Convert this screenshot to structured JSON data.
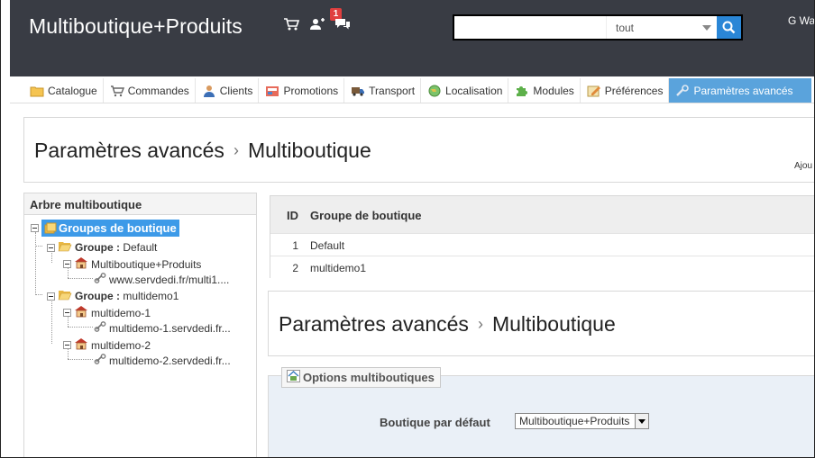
{
  "header": {
    "brand": "Multiboutique+Produits",
    "notifications_count": "1",
    "search_placeholder": "",
    "search_scope": "tout",
    "user": "G Wa"
  },
  "tabs": [
    {
      "label": "Catalogue",
      "icon": "folder-icon"
    },
    {
      "label": "Commandes",
      "icon": "cart-icon"
    },
    {
      "label": "Clients",
      "icon": "user-icon"
    },
    {
      "label": "Promotions",
      "icon": "promotion-icon"
    },
    {
      "label": "Transport",
      "icon": "truck-icon"
    },
    {
      "label": "Localisation",
      "icon": "globe-icon"
    },
    {
      "label": "Modules",
      "icon": "puzzle-icon"
    },
    {
      "label": "Préférences",
      "icon": "preferences-icon"
    },
    {
      "label": "Paramètres avancés",
      "icon": "tools-icon"
    }
  ],
  "page_title": {
    "parent": "Paramètres avancés",
    "current": "Multiboutique",
    "action_truncated": "Ajou"
  },
  "tree": {
    "title": "Arbre multiboutique",
    "root": "Groupes de boutique",
    "group_prefix": "Groupe :",
    "groups": [
      {
        "name": "Default",
        "shops": [
          {
            "name": "Multiboutique+Produits",
            "url": "www.servdedi.fr/multi1...."
          }
        ]
      },
      {
        "name": "multidemo1",
        "shops": [
          {
            "name": "multidemo-1",
            "url": "multidemo-1.servdedi.fr..."
          },
          {
            "name": "multidemo-2",
            "url": "multidemo-2.servdedi.fr..."
          }
        ]
      }
    ]
  },
  "table": {
    "headers": {
      "id": "ID",
      "name": "Groupe de boutique"
    },
    "rows": [
      {
        "id": "1",
        "name": "Default"
      },
      {
        "id": "2",
        "name": "multidemo1"
      }
    ]
  },
  "options": {
    "legend": "Options multiboutiques",
    "default_shop_label": "Boutique par défaut",
    "default_shop_value": "Multiboutique+Produits"
  },
  "colors": {
    "header_bg": "#393c44",
    "accent": "#3d9ae8",
    "active_tab": "#5aa3dc",
    "badge": "#e03f3f",
    "options_bg": "#eaf0f7"
  }
}
